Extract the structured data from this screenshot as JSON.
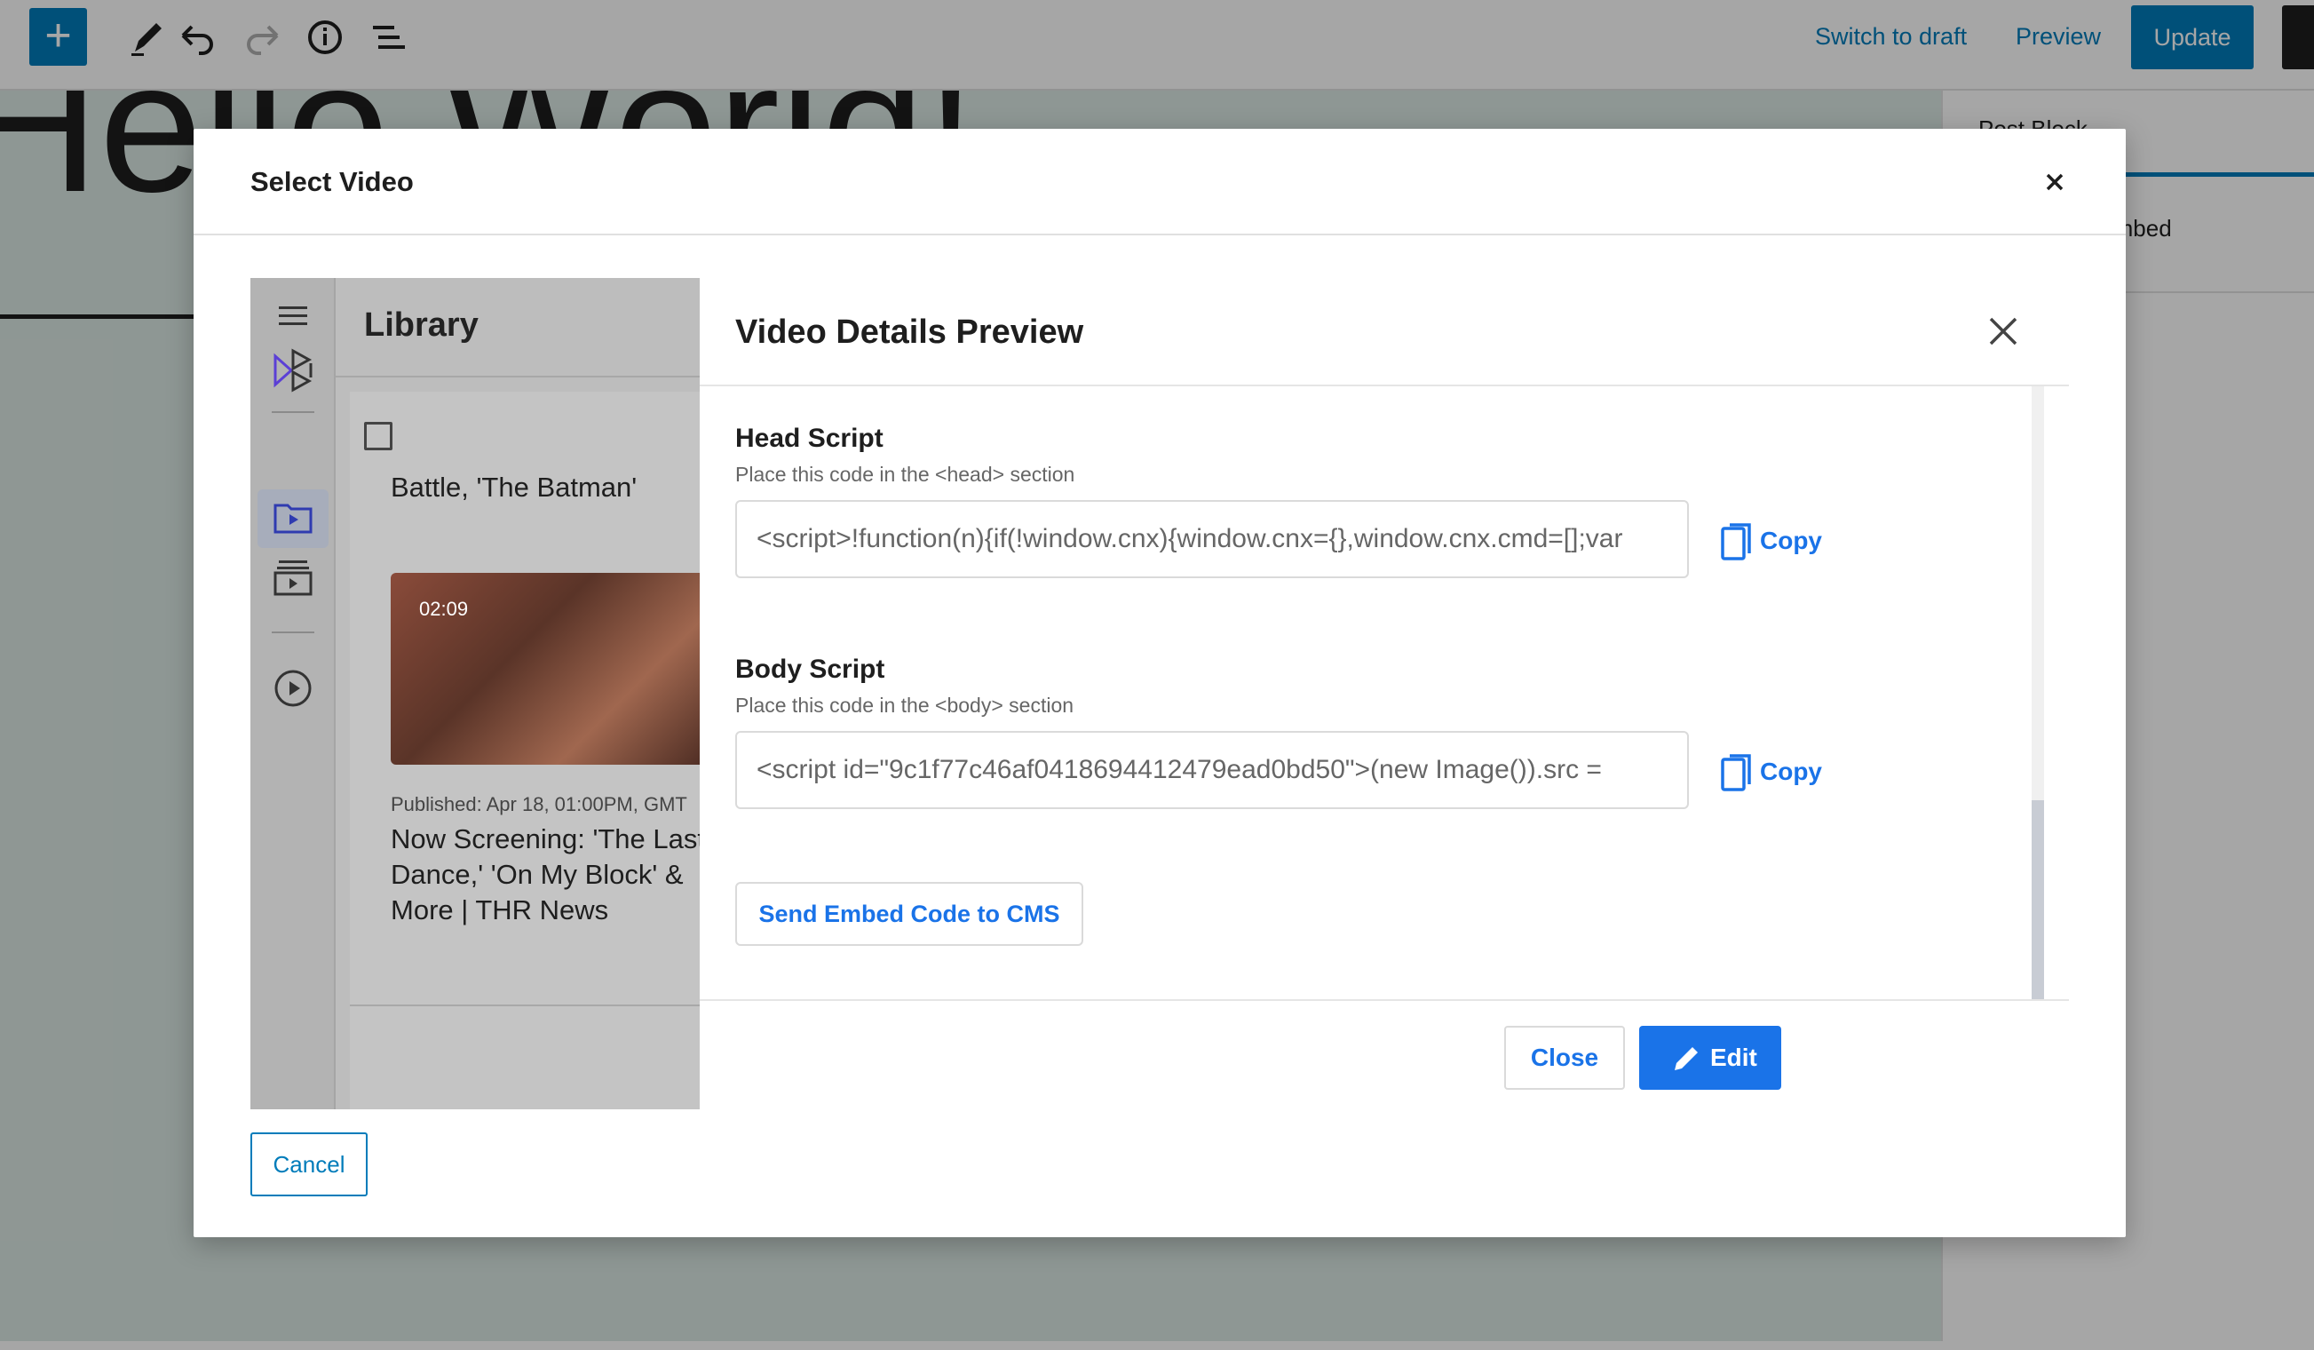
{
  "toolbar": {
    "add_icon": "plus-icon",
    "tools_icon": "pencil-icon",
    "undo_icon": "undo-icon",
    "redo_icon": "redo-icon",
    "info_icon": "info-icon",
    "list_icon": "list-view-icon",
    "switch_to_draft": "Switch to draft",
    "preview": "Preview",
    "update": "Update"
  },
  "editor": {
    "post_title": "Hello World!",
    "sidebar_tabs": "Post    Block",
    "sidebar_block_name": "Block: Video Embed"
  },
  "modal": {
    "title": "Select Video",
    "cancel_label": "Cancel"
  },
  "library": {
    "title": "Library",
    "item1_title_tail": "Battle, 'The Batman'",
    "video_duration": "02:09",
    "published": "Published: Apr 18, 01:00PM, GMT",
    "item2_title_lines": [
      "Now Screening: 'The Last",
      "Dance,' 'On My Block' &",
      "More | THR News"
    ]
  },
  "details": {
    "title": "Video Details Preview",
    "head_script_label": "Head Script",
    "head_script_hint": "Place this code in the <head> section",
    "head_script_value": "<script>!function(n){if(!window.cnx){window.cnx={},window.cnx.cmd=[];var",
    "body_script_label": "Body Script",
    "body_script_hint": "Place this code in the <body> section",
    "body_script_value": "<script id=\"9c1f77c46af0418694412479ead0bd50\">(new Image()).src = ",
    "copy_label": "Copy",
    "send_label": "Send Embed Code to CMS",
    "close_label": "Close",
    "edit_label": "Edit"
  },
  "colors": {
    "wp_blue": "#007cba",
    "accent_blue": "#1a73e8"
  }
}
